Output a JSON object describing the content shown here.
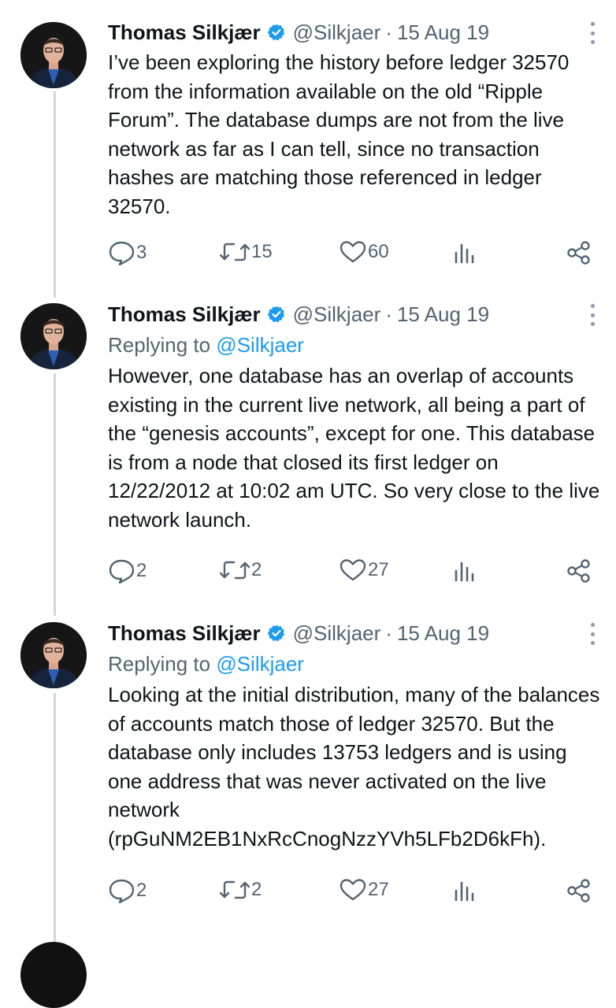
{
  "author": {
    "name": "Thomas Silkjær",
    "handle": "@Silkjaer"
  },
  "tweets": [
    {
      "date": "15 Aug 19",
      "replying": null,
      "text": "I’ve been exploring the history before ledger 32570 from the information available on the old “Ripple Forum”. The database dumps are not from the live network as far as I can tell, since no transaction hashes are matching those referenced in ledger 32570.",
      "replies": "3",
      "retweets": "15",
      "likes": "60"
    },
    {
      "date": "15 Aug 19",
      "replying": {
        "prefix": "Replying to",
        "mention": "@Silkjaer"
      },
      "text": "However, one database has an overlap of accounts existing in the current live network, all being a part of the “genesis accounts”, except for one. This database is from a node that closed its first ledger on 12/22/2012 at 10:02 am UTC. So very close to the live network launch.",
      "replies": "2",
      "retweets": "2",
      "likes": "27"
    },
    {
      "date": "15 Aug 19",
      "replying": {
        "prefix": "Replying to",
        "mention": "@Silkjaer"
      },
      "text": "Looking at the initial distribution, many of the balances of accounts match those of ledger 32570. But the database only includes 13753 ledgers and is using one address that was never activated on the live network (rpGuNM2EB1NxRcCnogNzzYVh5LFb2D6kFh).",
      "replies": "2",
      "retweets": "2",
      "likes": "27"
    }
  ],
  "separator": "·",
  "icons": {
    "reply": "reply-icon",
    "retweet": "retweet-icon",
    "like": "heart-icon",
    "views": "views-icon",
    "share": "share-icon",
    "verified": "verified-badge-icon",
    "more": "more-options-icon"
  },
  "colors": {
    "link": "#1d9bf0",
    "muted": "#536471",
    "verified": "#1d9bf0",
    "thread": "#cfd9de"
  }
}
